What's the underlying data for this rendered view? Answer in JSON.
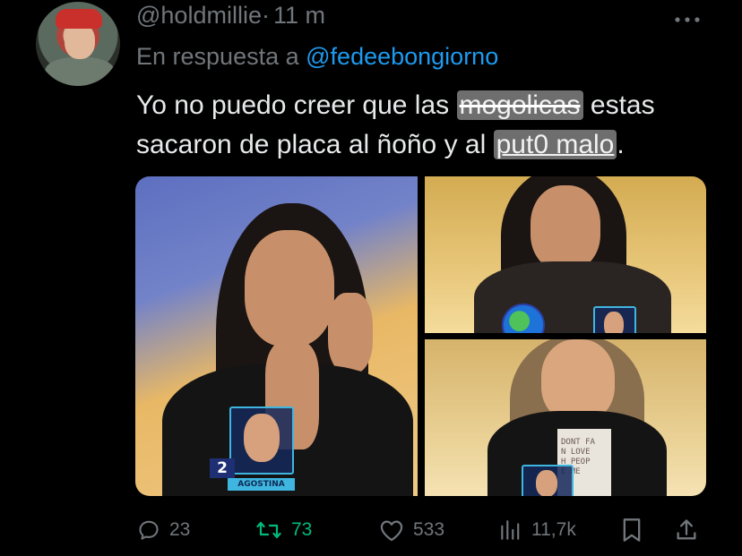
{
  "tweet": {
    "handle": "@holdmillie",
    "separator": "·",
    "time": "11 m",
    "more_icon": "more-horizontal-icon",
    "reply_prefix": "En respuesta a",
    "reply_to": "@fedeebongiorno",
    "text_part1": "Yo no puedo creer que las ",
    "masked1": "mogolicas",
    "text_part2": " estas sacaron de placa al ñoño y al ",
    "masked2": "put0 malo",
    "text_part3": "."
  },
  "media": {
    "badge1_number": "2",
    "badge1_name": "AGOSTINA",
    "shirt_lines": [
      "DONT FA",
      "N LOVE",
      "H PEOP",
      "E ME"
    ]
  },
  "actions": {
    "replies": "23",
    "retweets": "73",
    "likes": "533",
    "views": "11,7k"
  },
  "colors": {
    "accent": "#1d9bf0",
    "retweet_green": "#00ba7c",
    "muted": "#71767b",
    "text": "#e7e9ea"
  }
}
